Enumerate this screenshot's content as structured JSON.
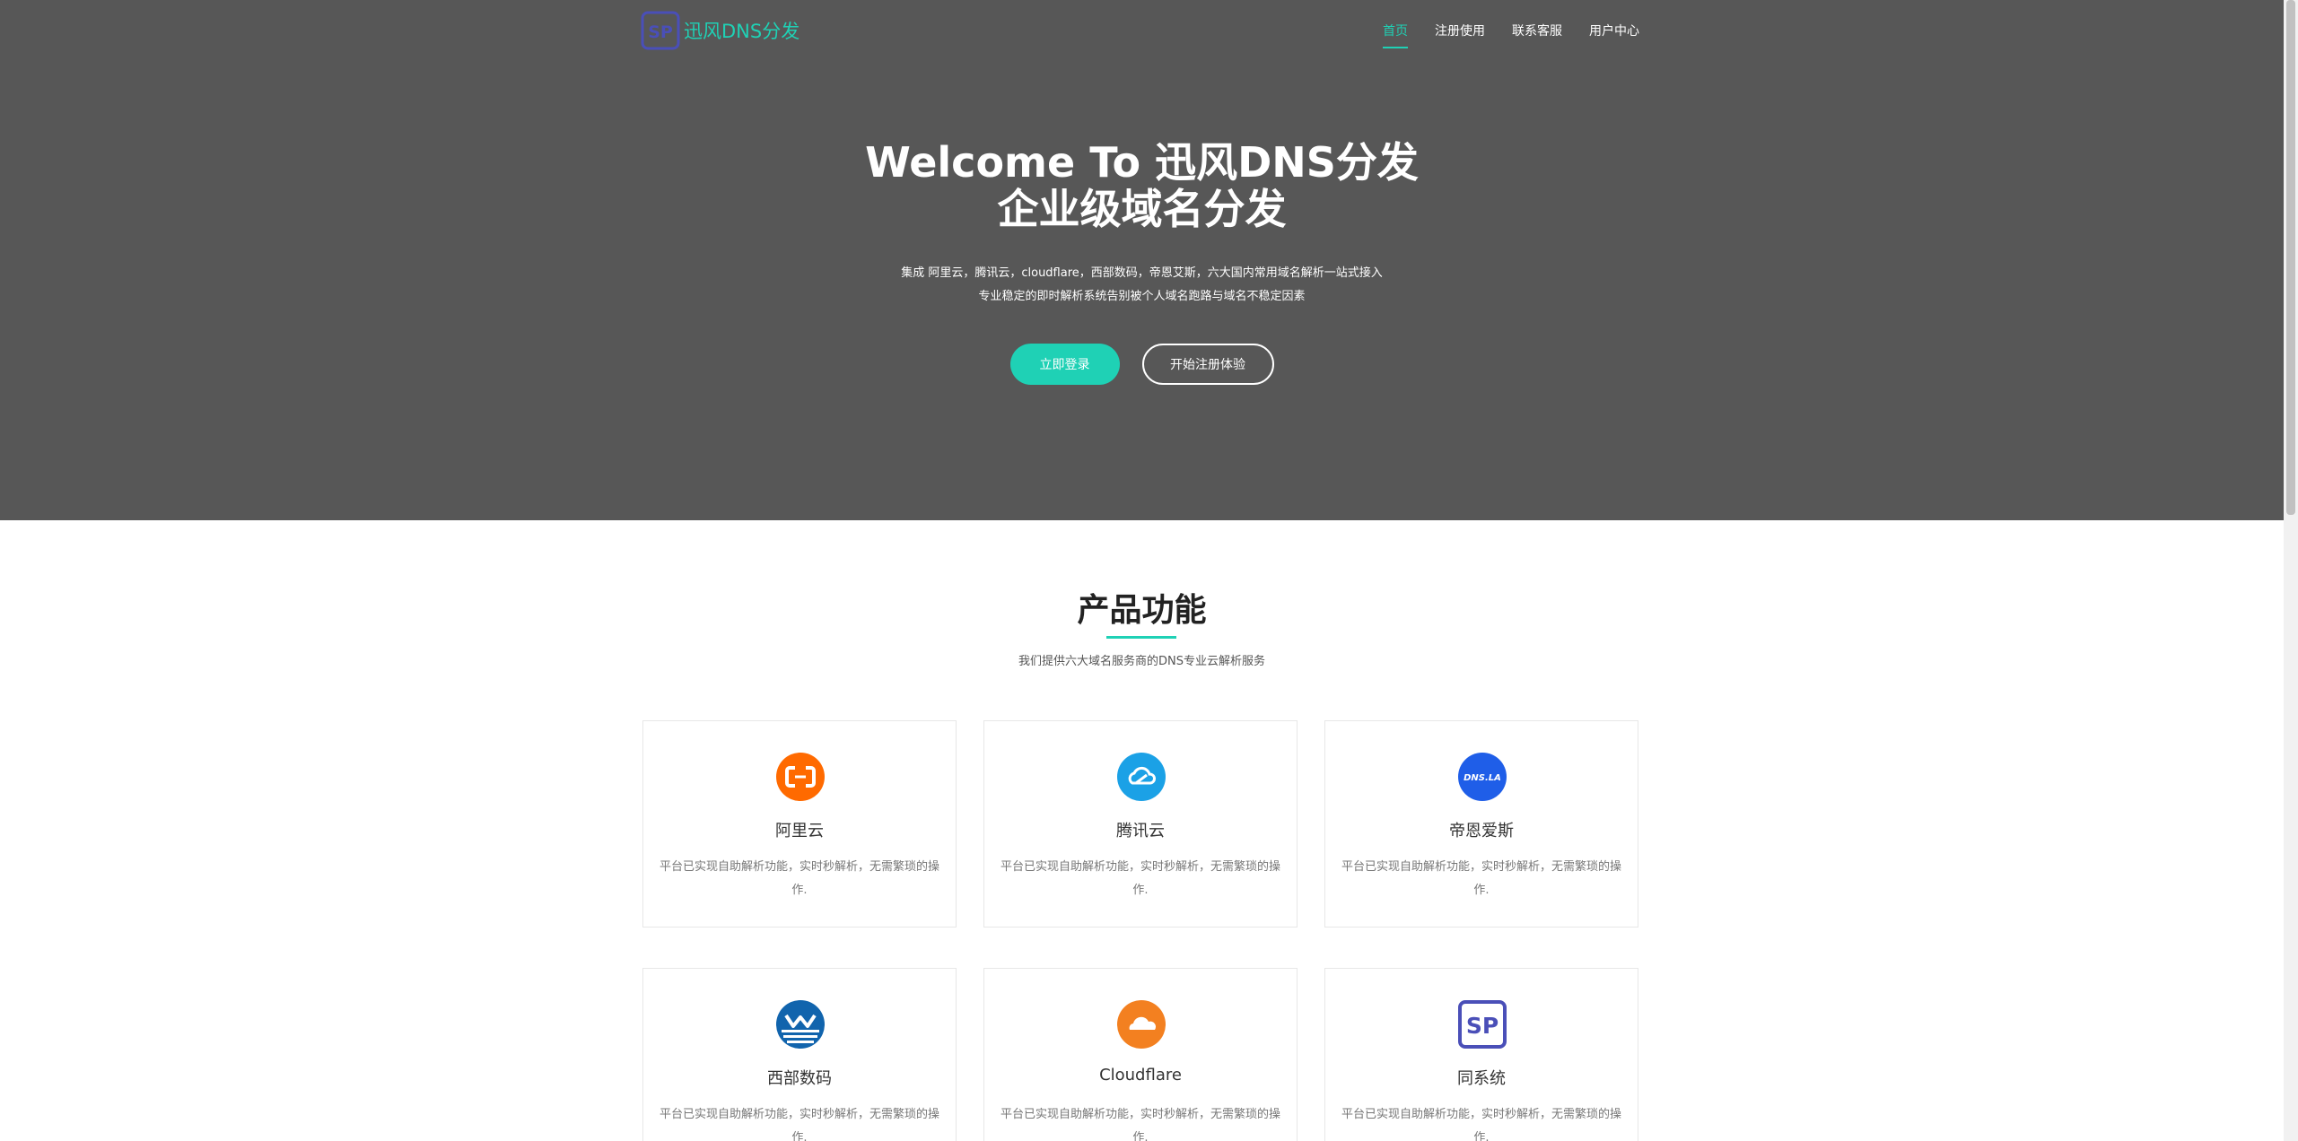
{
  "brand": {
    "logo_text": "SP",
    "name": "迅风DNS分发"
  },
  "nav": {
    "items": [
      "首页",
      "注册使用",
      "联系客服",
      "用户中心"
    ],
    "active": 0
  },
  "hero": {
    "title_line1": "Welcome To 迅风DNS分发",
    "title_line2": "企业级域名分发",
    "sub_line1": "集成 阿里云，腾讯云，cloudflare，西部数码，帝恩艾斯，六大国内常用域名解析一站式接入",
    "sub_line2": "专业稳定的即时解析系统告别被个人域名跑路与域名不稳定因素",
    "btn_login": "立即登录",
    "btn_register": "开始注册体验"
  },
  "features": {
    "title": "产品功能",
    "subtitle": "我们提供六大域名服务商的DNS专业云解析服务",
    "cards": [
      {
        "title": "阿里云",
        "desc": "平台已实现自助解析功能，实时秒解析，无需繁琐的操作.",
        "icon": "aliyun-icon"
      },
      {
        "title": "腾讯云",
        "desc": "平台已实现自助解析功能，实时秒解析，无需繁琐的操作.",
        "icon": "tencent-cloud-icon"
      },
      {
        "title": "帝恩爱斯",
        "desc": "平台已实现自助解析功能，实时秒解析，无需繁琐的操作.",
        "icon": "dnsla-icon",
        "icon_text": "DNS.LA"
      },
      {
        "title": "西部数码",
        "desc": "平台已实现自助解析功能，实时秒解析，无需繁琐的操作.",
        "icon": "west-icon"
      },
      {
        "title": "Cloudflare",
        "desc": "平台已实现自助解析功能，实时秒解析，无需繁琐的操作.",
        "icon": "cloudflare-icon"
      },
      {
        "title": "同系统",
        "desc": "平台已实现自助解析功能，实时秒解析，无需繁琐的操作.",
        "icon": "sp-icon",
        "icon_text": "SP"
      }
    ]
  },
  "colors": {
    "accent": "#1fd1b5",
    "hero_bg": "#575757",
    "aliyun": "#ff6a00",
    "tencent": "#1ba1e6",
    "dnsla": "#1f5ee8",
    "west": "#1164ad",
    "cloudflare": "#f38020",
    "sp": "#4a4fb8"
  }
}
